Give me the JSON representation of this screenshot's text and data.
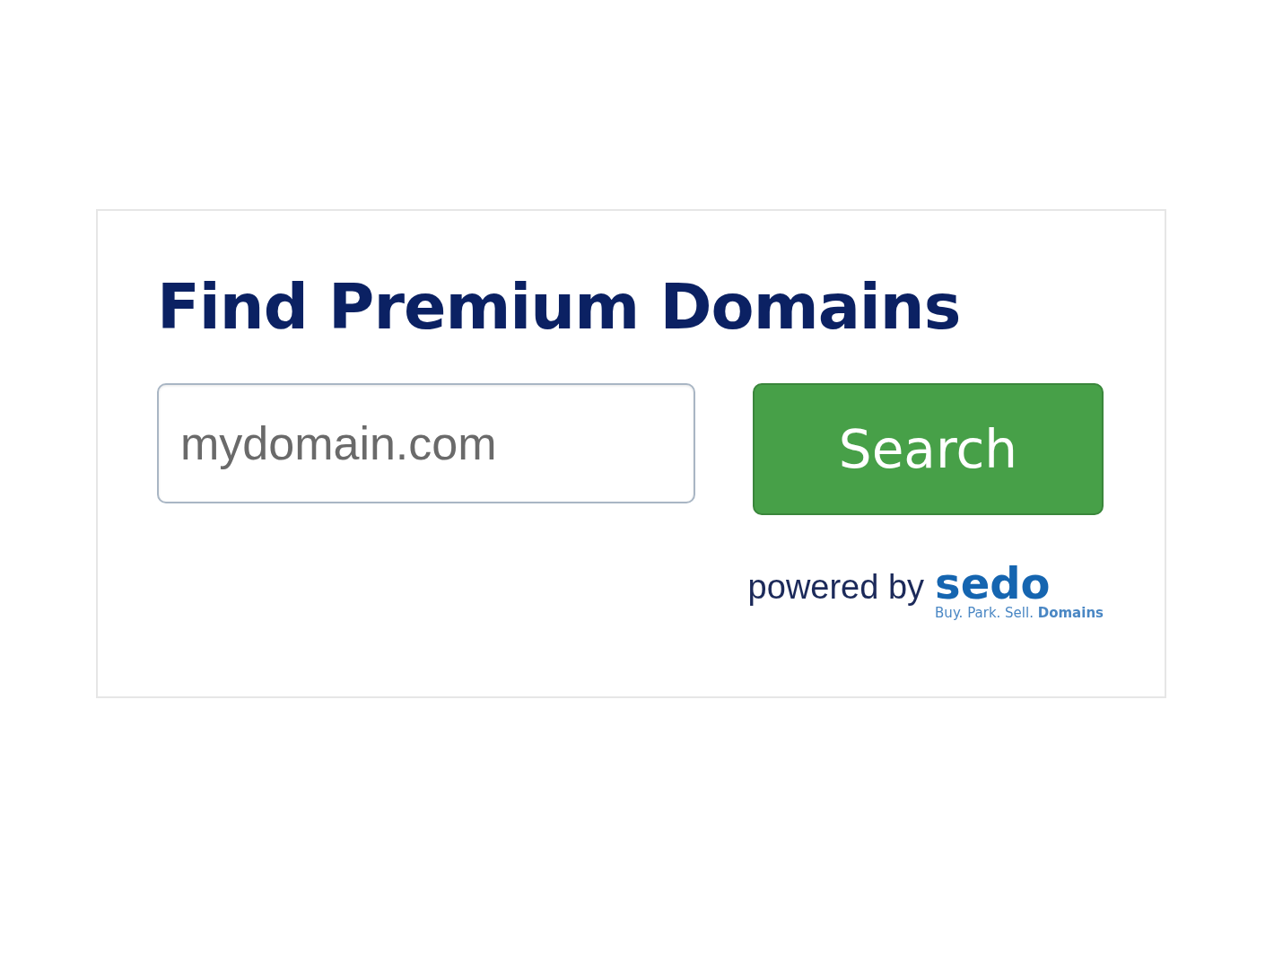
{
  "widget": {
    "title": "Find Premium Domains",
    "search": {
      "placeholder": "mydomain.com"
    },
    "button": "Search",
    "powered_by": "powered by",
    "logo": "sedo",
    "tagline": "Buy. Park. Sell. **Domains**"
  }
}
